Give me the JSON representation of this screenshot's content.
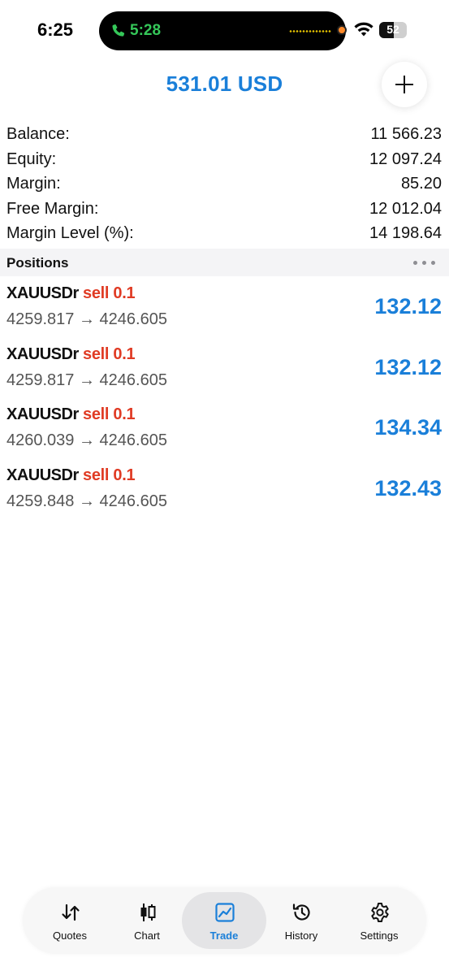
{
  "status_bar": {
    "time": "6:25",
    "call_time": "5:28",
    "battery": "52"
  },
  "header": {
    "title": "531.01 USD",
    "accent_color": "#1a7fd9"
  },
  "summary": [
    {
      "label": "Balance:",
      "value": "11 566.23"
    },
    {
      "label": "Equity:",
      "value": "12 097.24"
    },
    {
      "label": "Margin:",
      "value": "85.20"
    },
    {
      "label": "Free Margin:",
      "value": "12 012.04"
    },
    {
      "label": "Margin Level (%):",
      "value": "14 198.64"
    }
  ],
  "positions": {
    "title": "Positions",
    "items": [
      {
        "symbol": "XAUUSDr",
        "side": "sell 0.1",
        "prices": "4259.817 → 4246.605",
        "profit": "132.12"
      },
      {
        "symbol": "XAUUSDr",
        "side": "sell 0.1",
        "prices": "4259.817 → 4246.605",
        "profit": "132.12"
      },
      {
        "symbol": "XAUUSDr",
        "side": "sell 0.1",
        "prices": "4260.039 → 4246.605",
        "profit": "134.34"
      },
      {
        "symbol": "XAUUSDr",
        "side": "sell 0.1",
        "prices": "4259.848 → 4246.605",
        "profit": "132.43"
      }
    ]
  },
  "tabs": [
    {
      "label": "Quotes",
      "icon": "arrows-updown-icon"
    },
    {
      "label": "Chart",
      "icon": "candlestick-icon"
    },
    {
      "label": "Trade",
      "icon": "trade-chart-icon",
      "active": true
    },
    {
      "label": "History",
      "icon": "history-icon"
    },
    {
      "label": "Settings",
      "icon": "gear-icon"
    }
  ],
  "colors": {
    "sell": "#e03b24",
    "profit": "#1a7fd9",
    "active_tab": "#1a7fd9"
  }
}
